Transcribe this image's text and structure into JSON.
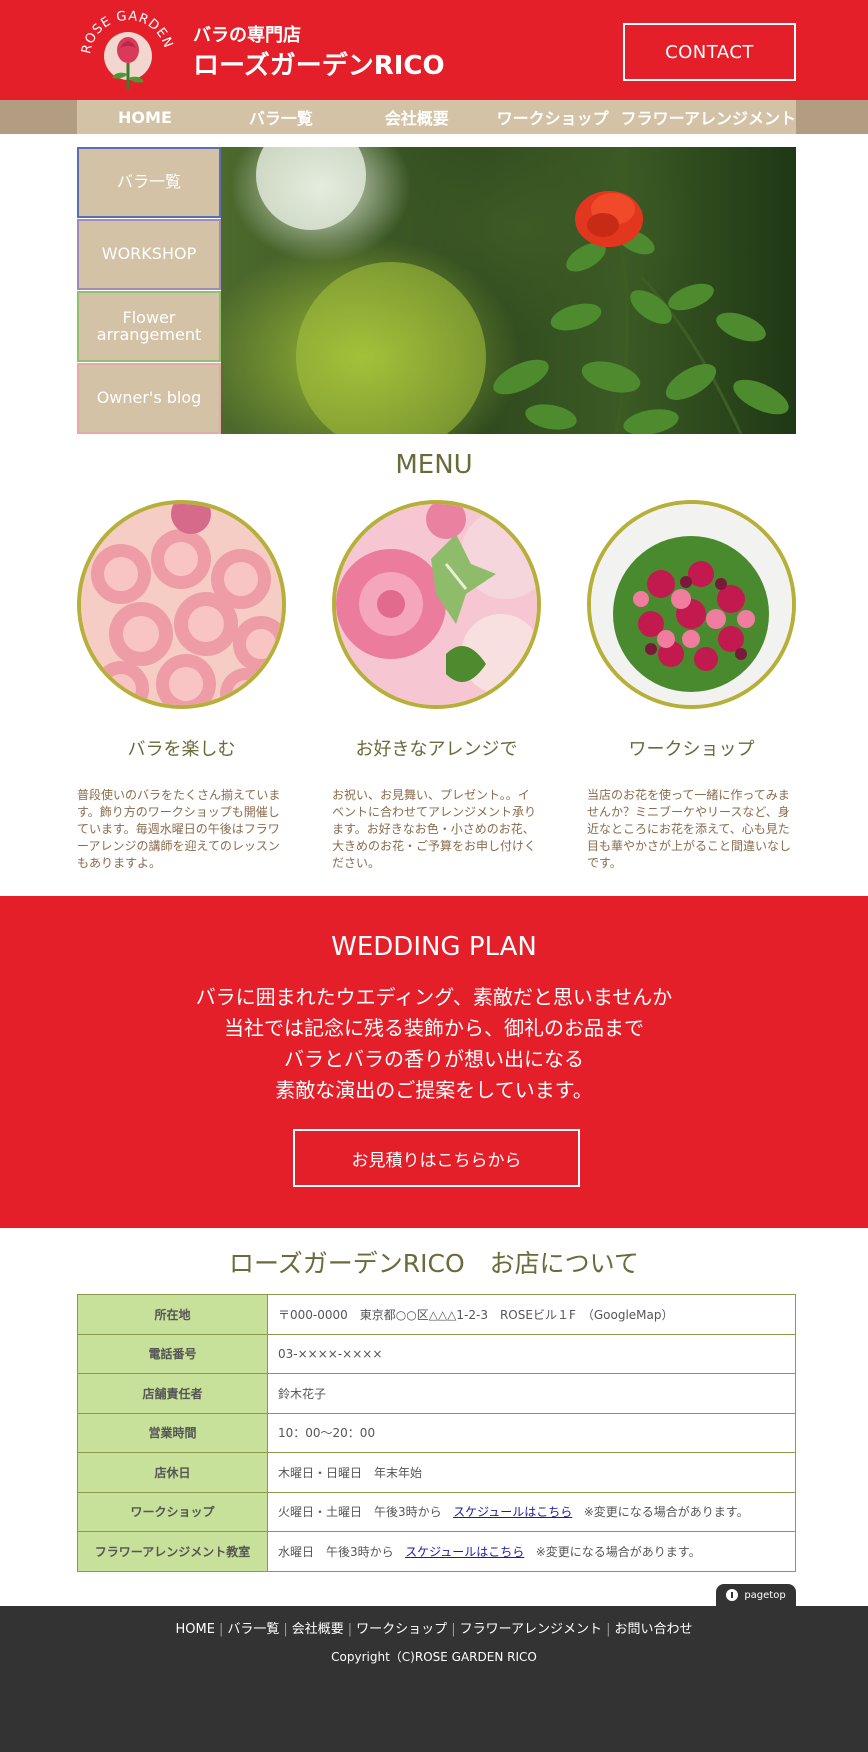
{
  "header": {
    "logo_text": "ROSE GARDEN RICO",
    "subtitle": "バラの専門店",
    "title": "ローズガーデンRICO",
    "contact_label": "CONTACT",
    "colors": {
      "brand_red": "#e41f2a",
      "nav_beige": "#d3c2a5"
    }
  },
  "nav": {
    "items": [
      {
        "label": "HOME"
      },
      {
        "label": "バラ一覧"
      },
      {
        "label": "会社概要"
      },
      {
        "label": "ワークショップ"
      },
      {
        "label": "フラワーアレンジメント"
      }
    ]
  },
  "side_menu": {
    "items": [
      {
        "label": "バラ一覧"
      },
      {
        "label": "WORKSHOP"
      },
      {
        "label": "Flower arrangement"
      },
      {
        "label": "Owner's blog"
      }
    ]
  },
  "menu": {
    "title": "MENU",
    "cards": [
      {
        "heading": "バラを楽しむ",
        "text": "普段使いのバラをたくさん揃えています。飾り方のワークショップも開催しています。毎週水曜日の午後はフラワーアレンジの講師を迎えてのレッスンもありますよ。"
      },
      {
        "heading": "お好きなアレンジで",
        "text": "お祝い、お見舞い、プレゼント。。イベントに合わせてアレンジメント承ります。お好きなお色・小さめのお花、大きめのお花・ご予算をお申し付けください。"
      },
      {
        "heading": "ワークショップ",
        "text": "当店のお花を使って一緒に作ってみませんか？ミニブーケやリースなど、身近なところにお花を添えて、心も見た目も華やかさが上がること間違いなしです。"
      }
    ]
  },
  "wedding": {
    "title": "WEDDING PLAN",
    "lines": [
      "バラに囲まれたウエディング、素敵だと思いませんか",
      "当社では記念に残る装飾から、御礼のお品まで",
      "バラとバラの香りが想い出になる",
      "素敵な演出のご提案をしています。"
    ],
    "button_label": "お見積りはこちらから"
  },
  "shop": {
    "title": "ローズガーデンRICO　お店について",
    "rows": [
      {
        "key": "所在地",
        "value": "〒000-0000　東京都○○区△△△1-2-3　ROSEビル１F　（GoogleMap）"
      },
      {
        "key": "電話番号",
        "value": "03-××××-××××"
      },
      {
        "key": "店舗責任者",
        "value": "鈴木花子"
      },
      {
        "key": "営業時間",
        "value": "10：00〜20：00"
      },
      {
        "key": "店休日",
        "value": "木曜日・日曜日　年末年始"
      },
      {
        "key": "ワークショップ",
        "value": "火曜日・土曜日　午後3時から",
        "link": "スケジュールはこちら",
        "note": "※変更になる場合があります。"
      },
      {
        "key": "フラワーアレンジメント教室",
        "value": "水曜日　午後3時から",
        "link": "スケジュールはこちら",
        "note": "※変更になる場合があります。"
      }
    ]
  },
  "footer": {
    "pagetop_label": "pagetop",
    "links": [
      "HOME",
      "バラ一覧",
      "会社概要",
      "ワークショップ",
      "フラワーアレンジメント",
      "お問い合わせ"
    ],
    "copyright": "Copyright（C)ROSE GARDEN RICO"
  }
}
